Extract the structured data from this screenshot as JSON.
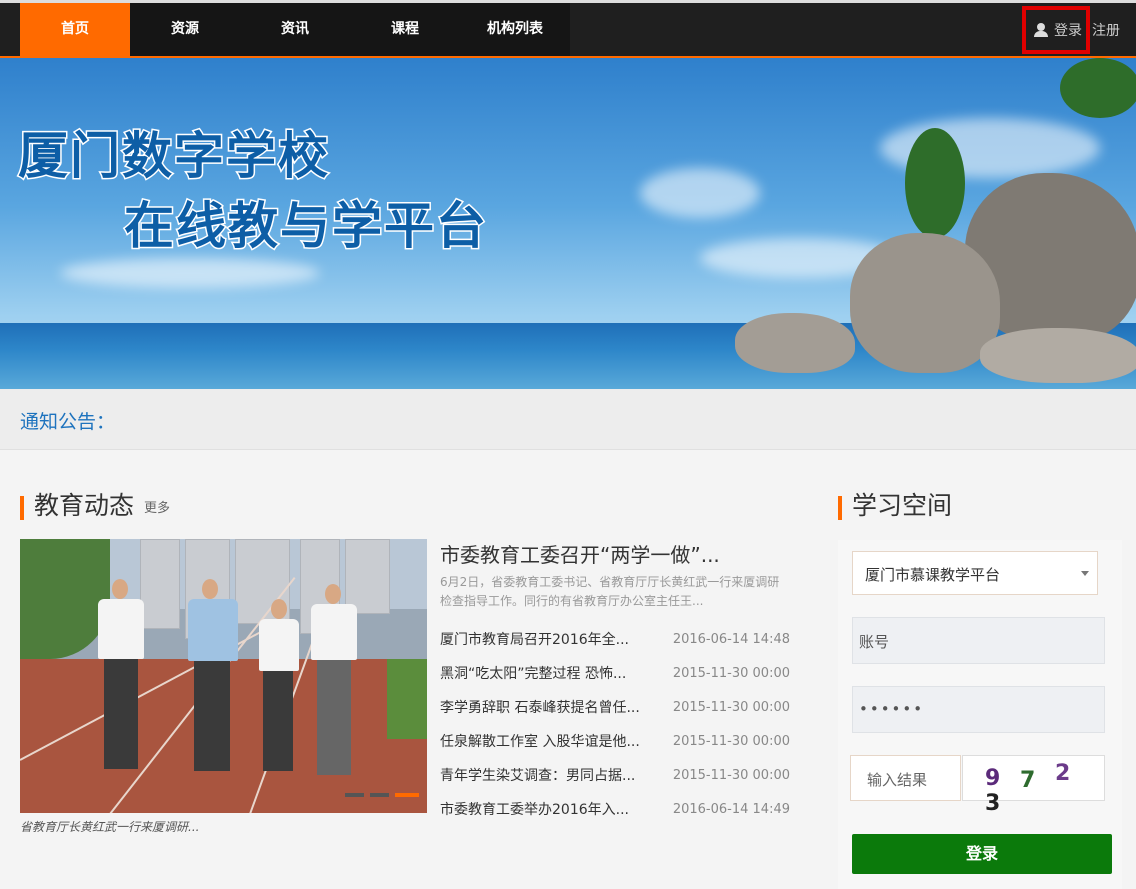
{
  "nav": {
    "items": [
      {
        "label": "首页",
        "active": true
      },
      {
        "label": "资源"
      },
      {
        "label": "资讯"
      },
      {
        "label": "课程"
      },
      {
        "label": "机构列表"
      }
    ],
    "login_label": "登录",
    "register_label": "注册",
    "user_icon": "user-icon"
  },
  "banner": {
    "title_line1": "厦门数字学校",
    "title_line2": "在线教与学平台"
  },
  "notice": {
    "label": "通知公告："
  },
  "news": {
    "section_title": "教育动态",
    "more_label": "更多",
    "photo_caption": "省教育厅长黄红武一行来厦调研...",
    "headline": "市委教育工委召开“两学一做”...",
    "summary": "6月2日，省委教育工委书记、省教育厅厅长黄红武一行来厦调研检查指导工作。同行的有省教育厅办公室主任王...",
    "items": [
      {
        "title": "厦门市教育局召开2016年全...",
        "date": "2016-06-14 14:48"
      },
      {
        "title": "黑洞“吃太阳”完整过程 恐怖...",
        "date": "2015-11-30 00:00"
      },
      {
        "title": "李学勇辞职 石泰峰获提名曾任...",
        "date": "2015-11-30 00:00"
      },
      {
        "title": "任泉解散工作室 入股华谊是他...",
        "date": "2015-11-30 00:00"
      },
      {
        "title": "青年学生染艾调查：男同占据...",
        "date": "2015-11-30 00:00"
      },
      {
        "title": "市委教育工委举办2016年入...",
        "date": "2016-06-14 14:49"
      }
    ]
  },
  "study": {
    "section_title": "学习空间",
    "platform_select": "厦门市慕课教学平台",
    "account_placeholder": "账号",
    "password_value": "••••••",
    "captcha_placeholder": "输入结果",
    "captcha_chars": [
      "9",
      "7",
      "2",
      "3"
    ],
    "captcha_colors": [
      "#5b2a7a",
      "#2e6b2e",
      "#6b3b8a",
      "#222222"
    ],
    "login_button": "登录"
  },
  "colors": {
    "accent": "#ff6a00",
    "login_green": "#0b7a0b",
    "link_blue": "#1e73be",
    "highlight_red": "#e00000"
  }
}
